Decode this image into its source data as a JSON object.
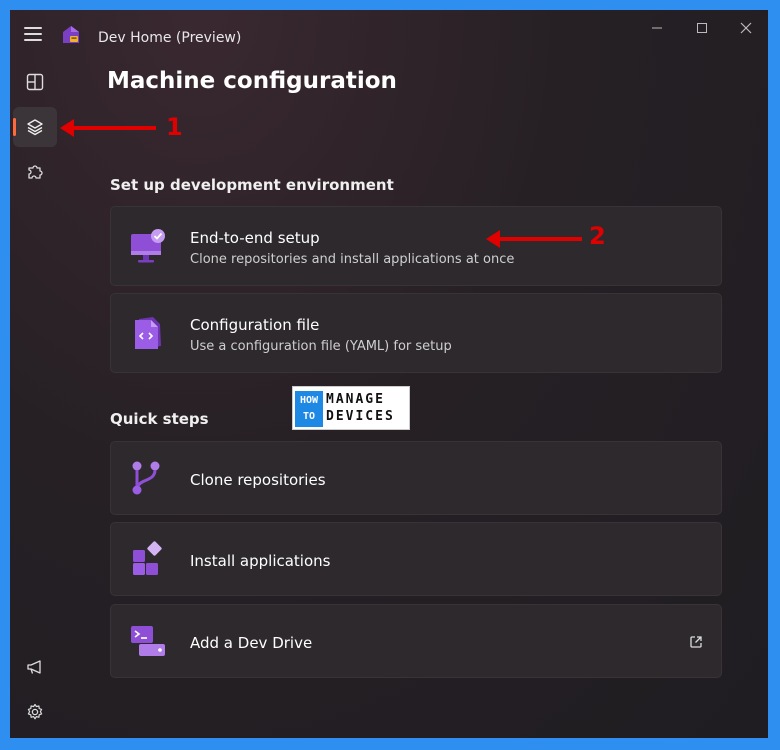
{
  "window": {
    "title": "Dev Home (Preview)"
  },
  "page": {
    "title": "Machine configuration"
  },
  "sections": {
    "setup": {
      "title": "Set up development environment",
      "cards": [
        {
          "title": "End-to-end setup",
          "desc": "Clone repositories and install applications at once"
        },
        {
          "title": "Configuration file",
          "desc": "Use a configuration file (YAML) for setup"
        }
      ]
    },
    "quick": {
      "title": "Quick steps",
      "items": [
        {
          "title": "Clone repositories"
        },
        {
          "title": "Install applications"
        },
        {
          "title": "Add a Dev Drive"
        }
      ]
    }
  },
  "annotations": {
    "one": "1",
    "two": "2"
  },
  "watermark": {
    "how": "HOW",
    "to": "TO",
    "manage": "MANAGE",
    "devices": "DEVICES"
  },
  "colors": {
    "accent": "#ff6a3d",
    "frame": "#2f8ff0",
    "annotation": "#e00000",
    "icon_purple": "#9b5de5"
  }
}
